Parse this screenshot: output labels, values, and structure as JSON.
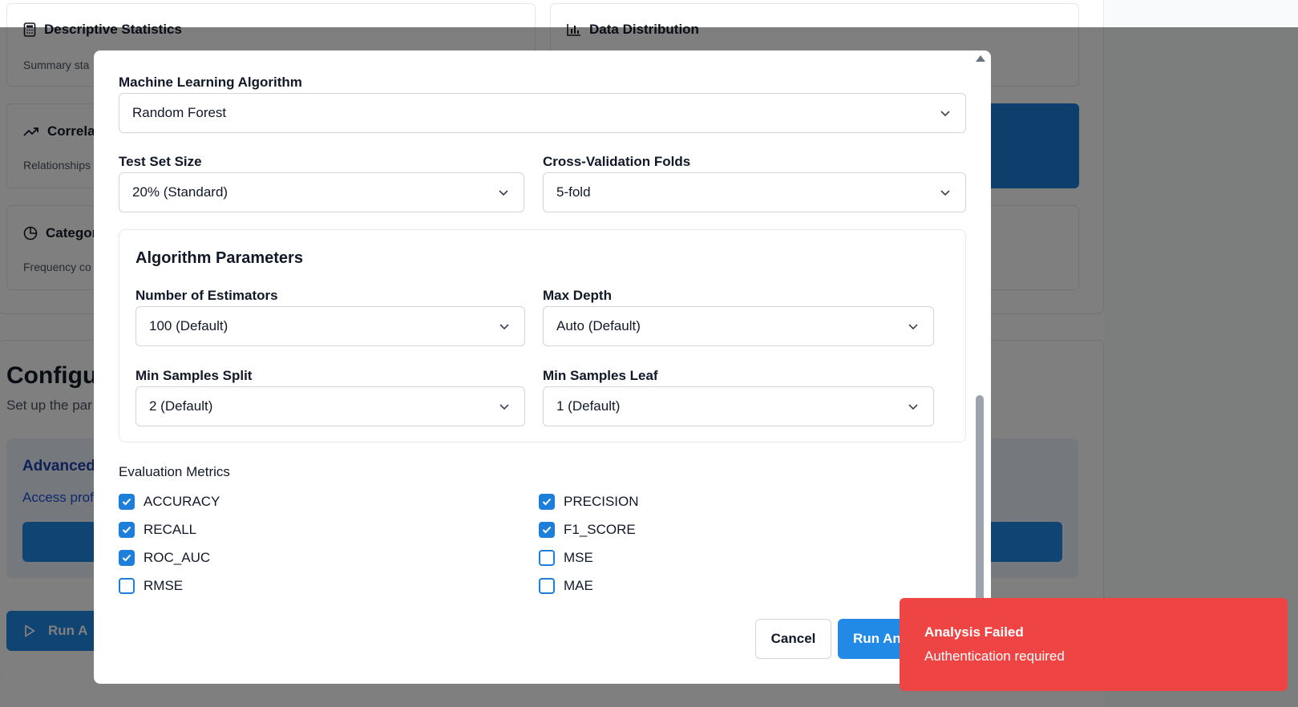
{
  "background": {
    "cards": [
      {
        "title": "Descriptive Statistics",
        "subtitle": "Summary sta",
        "icon": "calculator-icon"
      },
      {
        "title": "Data Distribution",
        "subtitle": "",
        "icon": "bar-chart-icon"
      },
      {
        "title": "Correla",
        "subtitle": "Relationships",
        "icon": "trending-up-icon"
      },
      {
        "title": "Categor",
        "subtitle": "Frequency co",
        "icon": "pie-chart-icon"
      }
    ],
    "config_heading": "Configur",
    "config_subtitle": "Set up the par",
    "advanced": {
      "title": "Advanced",
      "subtitle": "Access prof"
    },
    "run_button_label": "Run A",
    "run_button_icon": "play-icon"
  },
  "modal": {
    "algorithm": {
      "label": "Machine Learning Algorithm",
      "value": "Random Forest"
    },
    "test_set_size": {
      "label": "Test Set Size",
      "value": "20% (Standard)"
    },
    "cv_folds": {
      "label": "Cross-Validation Folds",
      "value": "5-fold"
    },
    "params": {
      "title": "Algorithm Parameters",
      "n_estimators": {
        "label": "Number of Estimators",
        "value": "100 (Default)"
      },
      "max_depth": {
        "label": "Max Depth",
        "value": "Auto (Default)"
      },
      "min_samples_split": {
        "label": "Min Samples Split",
        "value": "2 (Default)"
      },
      "min_samples_leaf": {
        "label": "Min Samples Leaf",
        "value": "1 (Default)"
      }
    },
    "metrics": {
      "label": "Evaluation Metrics",
      "items": [
        {
          "name": "ACCURACY",
          "checked": true
        },
        {
          "name": "PRECISION",
          "checked": true
        },
        {
          "name": "RECALL",
          "checked": true
        },
        {
          "name": "F1_SCORE",
          "checked": true
        },
        {
          "name": "ROC_AUC",
          "checked": true
        },
        {
          "name": "MSE",
          "checked": false
        },
        {
          "name": "RMSE",
          "checked": false
        },
        {
          "name": "MAE",
          "checked": false
        }
      ]
    },
    "cancel_label": "Cancel",
    "run_label": "Run An"
  },
  "toast": {
    "title": "Analysis Failed",
    "message": "Authentication required"
  },
  "colors": {
    "primary": "#2189e6",
    "error": "#ef4444",
    "checkbox": "#1d7fd9"
  }
}
